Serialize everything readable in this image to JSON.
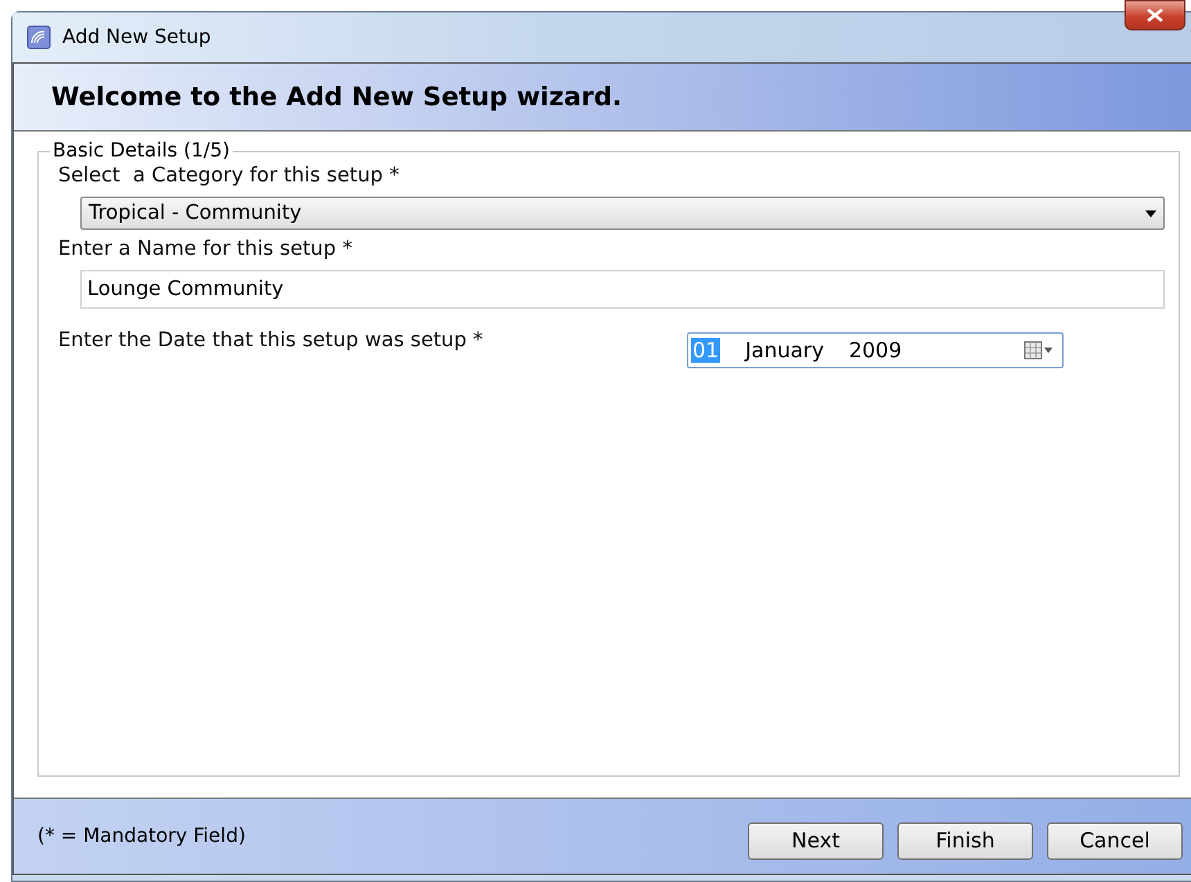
{
  "window": {
    "title": "Add New Setup"
  },
  "header": {
    "title": "Welcome to the Add New Setup wizard."
  },
  "group": {
    "legend": "Basic Details (1/5)"
  },
  "fields": [
    {
      "kind": "dropdown",
      "label": "Select  a Category for this setup *",
      "value": "Tropical - Community"
    },
    {
      "kind": "text",
      "label": "Enter a Name for this setup *",
      "value": "Lounge Community"
    },
    {
      "kind": "date",
      "label": "Enter the Date that this setup was setup *",
      "day": "01",
      "day_selected": true,
      "month": "January",
      "year": "2009"
    }
  ],
  "footer": {
    "note": "(* = Mandatory Field)",
    "buttons": [
      "Next",
      "Finish",
      "Cancel"
    ]
  }
}
